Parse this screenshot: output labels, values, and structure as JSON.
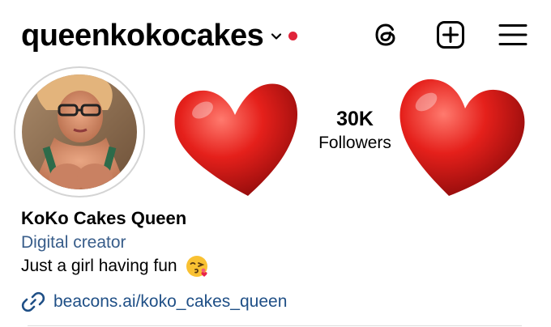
{
  "header": {
    "username": "queenkokocakes",
    "icons": [
      "chevron-down-icon",
      "notification-dot",
      "threads-icon",
      "new-post-icon",
      "menu-icon"
    ],
    "notification_dot_color": "#e0243a"
  },
  "profile": {
    "stats": [
      {
        "value": "30K",
        "label": "Followers"
      }
    ],
    "name": "KoKo Cakes Queen",
    "category": "Digital creator",
    "bio": "Just a girl having fun",
    "bio_emoji": "face-blowing-a-kiss-emoji",
    "link": "beacons.ai/koko_cakes_queen",
    "decorations": [
      "red-heart-emoji",
      "red-heart-emoji"
    ]
  },
  "colors": {
    "category_text": "#385d8a",
    "link_text": "#1f4f86",
    "heart_red": "#e5201b"
  }
}
